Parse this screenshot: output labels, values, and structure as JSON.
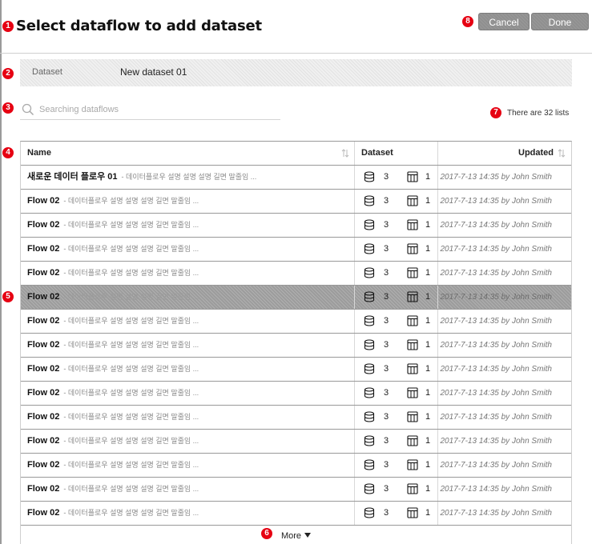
{
  "header": {
    "title": "Select dataflow to add dataset",
    "cancel_label": "Cancel",
    "done_label": "Done"
  },
  "badges": [
    "1",
    "2",
    "3",
    "4",
    "5",
    "6",
    "7",
    "8"
  ],
  "dataset": {
    "label": "Dataset",
    "value": "New dataset 01"
  },
  "search": {
    "placeholder": "Searching dataflows",
    "value": ""
  },
  "list_count": "There are 32 lists",
  "table": {
    "columns": {
      "name": "Name",
      "dataset": "Dataset",
      "updated": "Updated"
    },
    "selected_row": 5,
    "rows": [
      {
        "name": "새로운 데이터 플로우 01",
        "desc": "- 데이터플로우 설명 설명 설명 길면 말줄임 ...",
        "datasets": "3",
        "tables": "1",
        "updated": "2017-7-13 14:35 by John Smith"
      },
      {
        "name": "Flow 02",
        "desc": "- 데이터플로우 설명 설명 설명 길면 말줄임 ...",
        "datasets": "3",
        "tables": "1",
        "updated": "2017-7-13 14:35 by John Smith"
      },
      {
        "name": "Flow 02",
        "desc": "- 데이터플로우 설명 설명 설명 길면 말줄임 ...",
        "datasets": "3",
        "tables": "1",
        "updated": "2017-7-13 14:35 by John Smith"
      },
      {
        "name": "Flow 02",
        "desc": "- 데이터플로우 설명 설명 설명 길면 말줄임 ...",
        "datasets": "3",
        "tables": "1",
        "updated": "2017-7-13 14:35 by John Smith"
      },
      {
        "name": "Flow 02",
        "desc": "- 데이터플로우 설명 설명 설명 길면 말줄임 ...",
        "datasets": "3",
        "tables": "1",
        "updated": "2017-7-13 14:35 by John Smith"
      },
      {
        "name": "Flow 02",
        "desc": "- 데이터플로우 설명 설명 설명 길면 말줄임 ...",
        "datasets": "3",
        "tables": "1",
        "updated": "2017-7-13 14:35 by John Smith"
      },
      {
        "name": "Flow 02",
        "desc": "- 데이터플로우 설명 설명 설명 길면 말줄임 ...",
        "datasets": "3",
        "tables": "1",
        "updated": "2017-7-13 14:35 by John Smith"
      },
      {
        "name": "Flow 02",
        "desc": "- 데이터플로우 설명 설명 설명 길면 말줄임 ...",
        "datasets": "3",
        "tables": "1",
        "updated": "2017-7-13 14:35 by John Smith"
      },
      {
        "name": "Flow 02",
        "desc": "- 데이터플로우 설명 설명 설명 길면 말줄임 ...",
        "datasets": "3",
        "tables": "1",
        "updated": "2017-7-13 14:35 by John Smith"
      },
      {
        "name": "Flow 02",
        "desc": "- 데이터플로우 설명 설명 설명 길면 말줄임 ...",
        "datasets": "3",
        "tables": "1",
        "updated": "2017-7-13 14:35 by John Smith"
      },
      {
        "name": "Flow 02",
        "desc": "- 데이터플로우 설명 설명 설명 길면 말줄임 ...",
        "datasets": "3",
        "tables": "1",
        "updated": "2017-7-13 14:35 by John Smith"
      },
      {
        "name": "Flow 02",
        "desc": "- 데이터플로우 설명 설명 설명 길면 말줄임 ...",
        "datasets": "3",
        "tables": "1",
        "updated": "2017-7-13 14:35 by John Smith"
      },
      {
        "name": "Flow 02",
        "desc": "- 데이터플로우 설명 설명 설명 길면 말줄임 ...",
        "datasets": "3",
        "tables": "1",
        "updated": "2017-7-13 14:35 by John Smith"
      },
      {
        "name": "Flow 02",
        "desc": "- 데이터플로우 설명 설명 설명 길면 말줄임 ...",
        "datasets": "3",
        "tables": "1",
        "updated": "2017-7-13 14:35 by John Smith"
      },
      {
        "name": "Flow 02",
        "desc": "- 데이터플로우 설명 설명 설명 길면 말줄임 ...",
        "datasets": "3",
        "tables": "1",
        "updated": "2017-7-13 14:35 by John Smith"
      }
    ],
    "more_label": "More"
  },
  "icons": {
    "search": "search-icon",
    "sort": "sort-icon",
    "dataset": "database-icon",
    "table": "table-icon",
    "more": "triangle-down-icon"
  },
  "colors": {
    "badge": "#e60012",
    "button": "#8f8f8f",
    "selected_row": "#9c9c9c"
  }
}
